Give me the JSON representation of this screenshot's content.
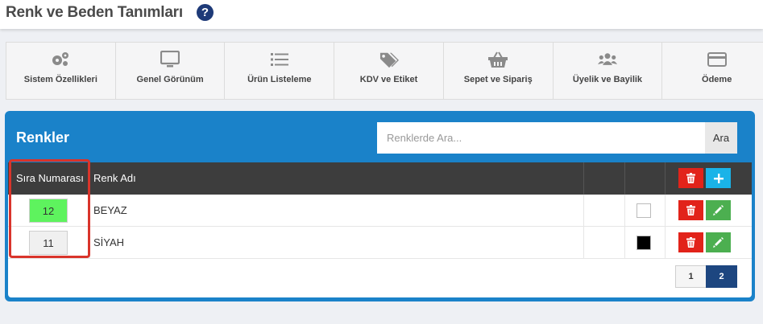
{
  "header": {
    "title": "Renk ve Beden Tanımları",
    "help_icon": "question-circle-icon"
  },
  "nav": {
    "items": [
      {
        "label": "Sistem Özellikleri",
        "icon": "gears-icon"
      },
      {
        "label": "Genel Görünüm",
        "icon": "monitor-icon"
      },
      {
        "label": "Ürün Listeleme",
        "icon": "list-icon"
      },
      {
        "label": "KDV ve Etiket",
        "icon": "tags-icon"
      },
      {
        "label": "Sepet ve Sipariş",
        "icon": "basket-icon"
      },
      {
        "label": "Üyelik ve Bayilik",
        "icon": "users-icon"
      },
      {
        "label": "Ödeme",
        "icon": "credit-card-icon"
      }
    ]
  },
  "panel": {
    "title": "Renkler",
    "search": {
      "placeholder": "Renklerde Ara...",
      "value": "",
      "button_label": "Ara"
    },
    "table": {
      "headers": [
        "Sıra Numarası",
        "Renk Adı",
        "",
        ""
      ],
      "rows": [
        {
          "order": "12",
          "name": "BEYAZ",
          "swatch_color": "#ffffff",
          "order_bg": "#5ef35e"
        },
        {
          "order": "11",
          "name": "SİYAH",
          "swatch_color": "#000000",
          "order_bg": "#f0f0f0"
        }
      ]
    },
    "pagination": {
      "pages": [
        "1",
        "2"
      ],
      "active": "2"
    }
  },
  "colors": {
    "panel_blue": "#1a82c9",
    "header_dark": "#3d3d3d",
    "delete_red": "#e2231a",
    "edit_green": "#4caf50",
    "add_cyan": "#1ab3e8",
    "highlight_red": "#d9342b"
  }
}
